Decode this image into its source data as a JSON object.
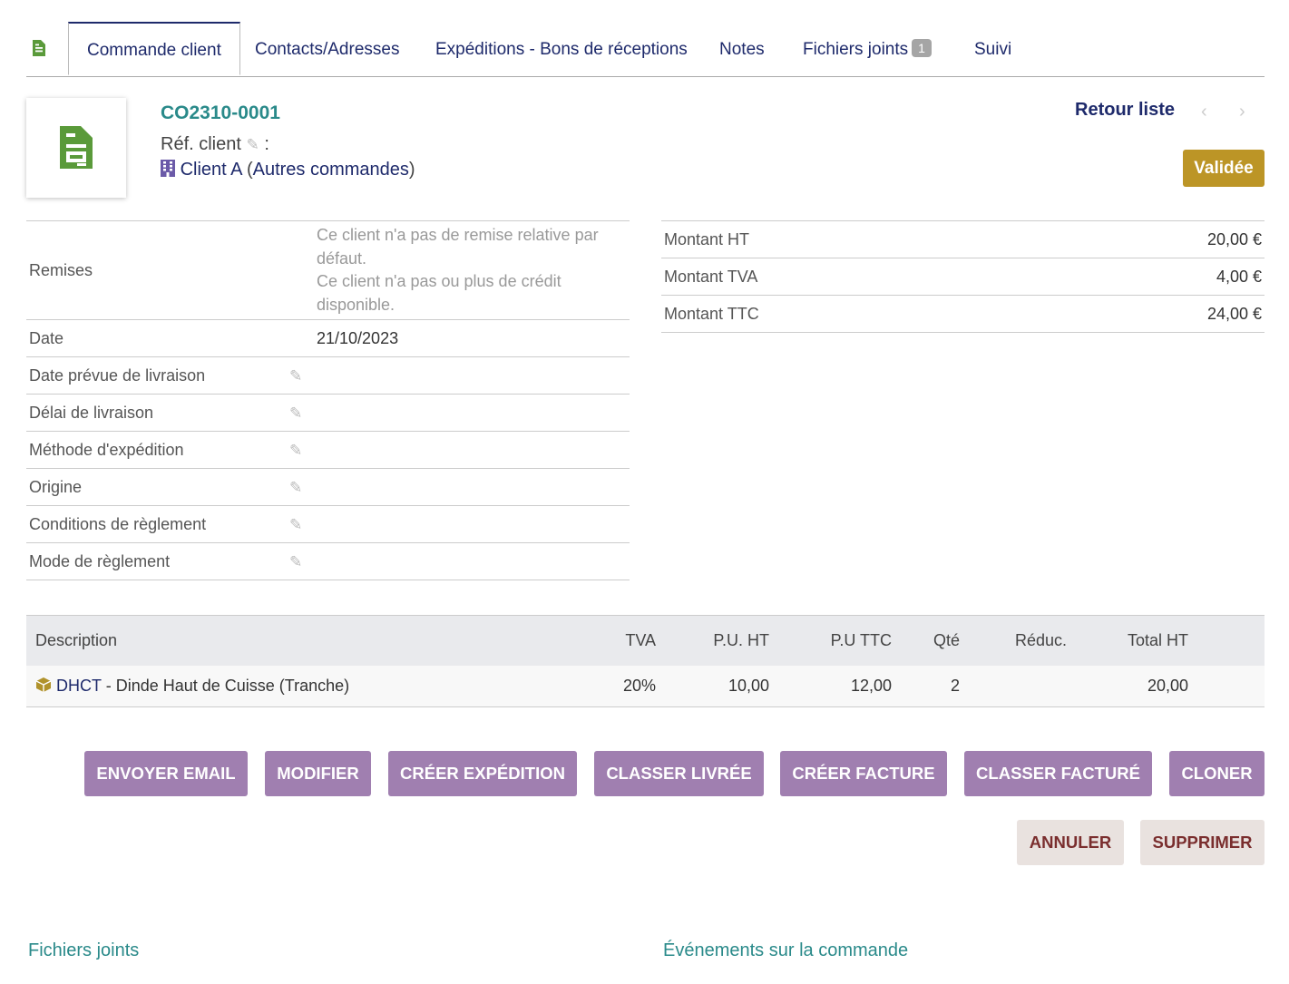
{
  "tabs": [
    {
      "label": "Commande client"
    },
    {
      "label": "Contacts/Adresses"
    },
    {
      "label": "Expéditions - Bons de réceptions"
    },
    {
      "label": "Notes"
    },
    {
      "label": "Fichiers joints",
      "badge": "1"
    },
    {
      "label": "Suivi"
    }
  ],
  "header": {
    "ref": "CO2310-0001",
    "ref_client_label": "Réf. client",
    "ref_client_sep": ":",
    "client_name": "Client A",
    "client_link": "Autres commandes",
    "back_to_list": "Retour liste",
    "prev": "‹",
    "next": "›",
    "status": "Validée"
  },
  "fields": {
    "remises_label": "Remises",
    "remises_line1": "Ce client n'a pas de remise relative par défaut.",
    "remises_line2": "Ce client n'a pas ou plus de crédit disponible.",
    "date_label": "Date",
    "date_value": "21/10/2023",
    "delivery_date_label": "Date prévue de livraison",
    "delivery_delay_label": "Délai de livraison",
    "shipping_method_label": "Méthode d'expédition",
    "origin_label": "Origine",
    "payment_terms_label": "Conditions de règlement",
    "payment_mode_label": "Mode de règlement"
  },
  "amounts": [
    {
      "label": "Montant HT",
      "value": "20,00 €"
    },
    {
      "label": "Montant TVA",
      "value": "4,00 €"
    },
    {
      "label": "Montant TTC",
      "value": "24,00 €"
    }
  ],
  "lines": {
    "headers": [
      "Description",
      "TVA",
      "P.U. HT",
      "P.U TTC",
      "Qté",
      "Réduc.",
      "Total HT"
    ],
    "rows": [
      {
        "ref": "DHCT",
        "desc": "- Dinde Haut de Cuisse (Tranche)",
        "tva": "20%",
        "pu_ht": "10,00",
        "pu_ttc": "12,00",
        "qty": "2",
        "reduc": "",
        "total_ht": "20,00"
      }
    ]
  },
  "actions": {
    "send_email": "ENVOYER EMAIL",
    "modify": "MODIFIER",
    "create_shipment": "CRÉER EXPÉDITION",
    "classify_delivered": "CLASSER LIVRÉE",
    "create_invoice": "CRÉER FACTURE",
    "classify_billed": "CLASSER FACTURÉ",
    "clone": "CLONER",
    "cancel": "ANNULER",
    "delete": "SUPPRIMER"
  },
  "sections": {
    "files": "Fichiers joints",
    "events": "Événements sur la commande"
  },
  "colors": {
    "accent": "#1e2a6b",
    "teal": "#2a8a8a",
    "button_primary": "#a07fb0",
    "status": "#bc9526"
  }
}
